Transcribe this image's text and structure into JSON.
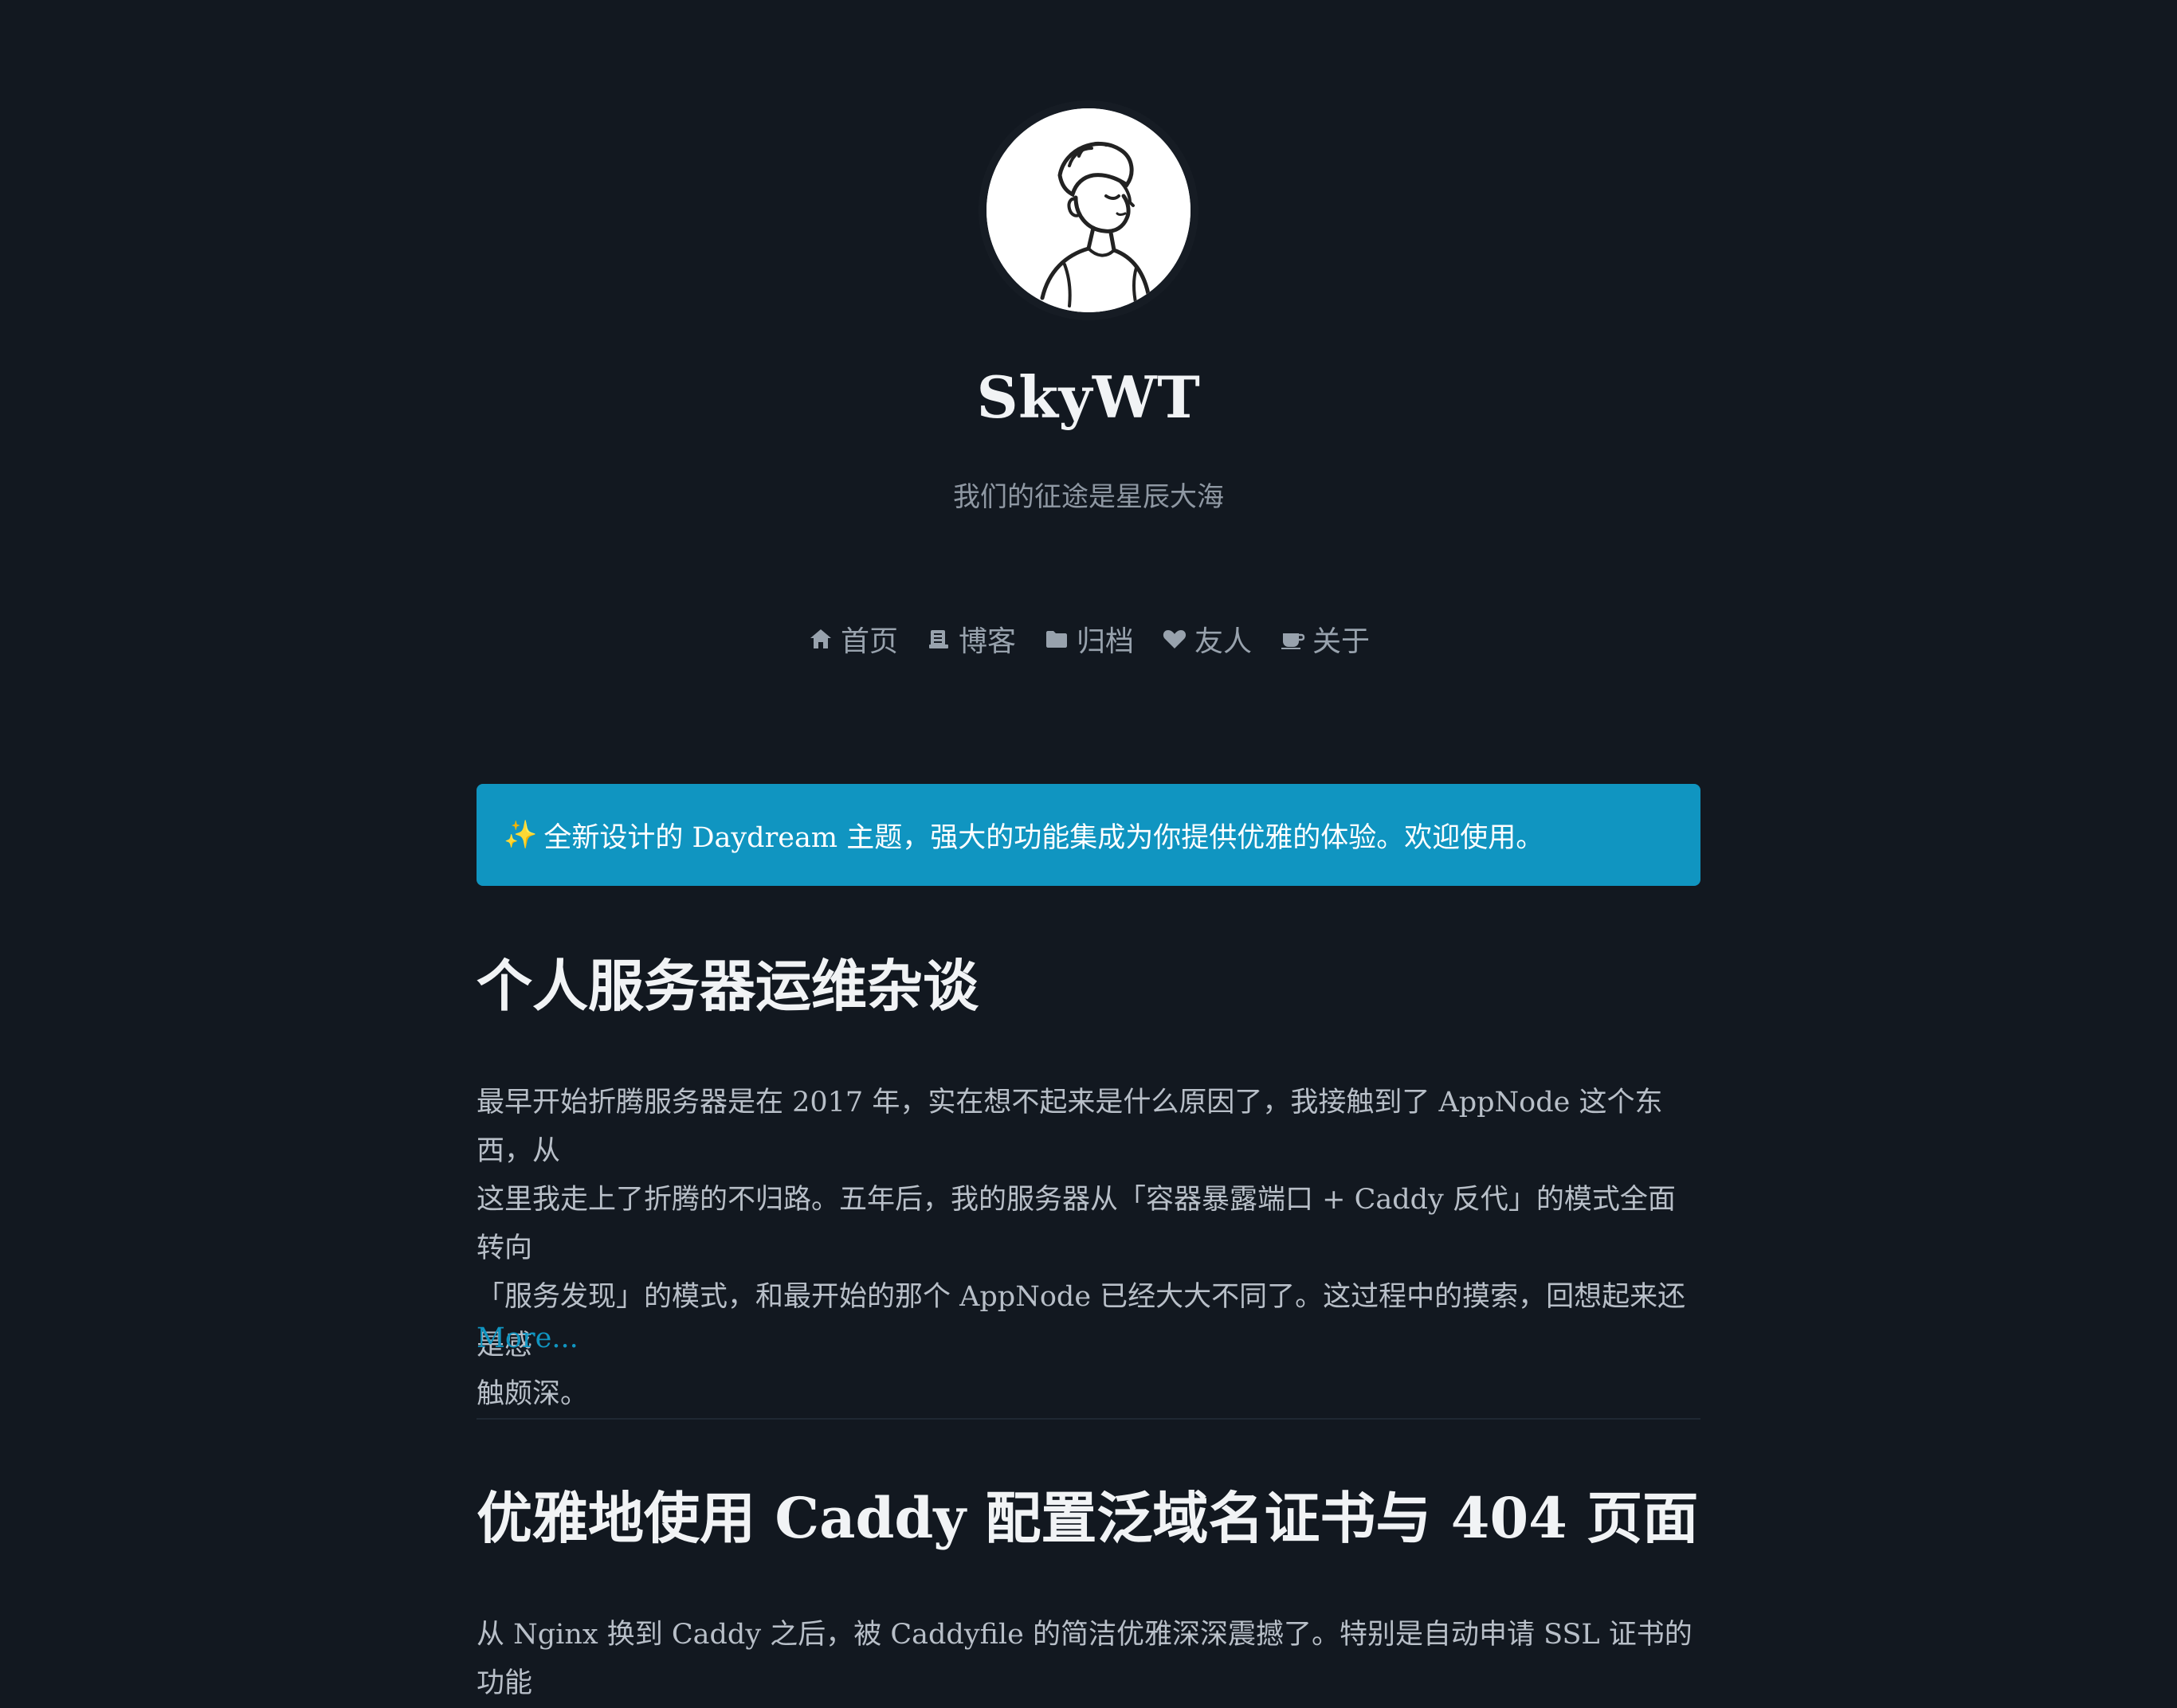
{
  "site": {
    "title": "SkyWT",
    "subtitle": "我们的征途是星辰大海"
  },
  "nav": [
    {
      "icon": "home-icon",
      "label": "首页"
    },
    {
      "icon": "blog-icon",
      "label": "博客"
    },
    {
      "icon": "folder-icon",
      "label": "归档"
    },
    {
      "icon": "heart-icon",
      "label": "友人"
    },
    {
      "icon": "coffee-icon",
      "label": "关于"
    }
  ],
  "notice": {
    "icon": "✨",
    "text": "全新设计的 Daydream 主题，强大的功能集成为你提供优雅的体验。欢迎使用。"
  },
  "posts": [
    {
      "title": "个人服务器运维杂谈",
      "excerpt_lines": [
        "最早开始折腾服务器是在 2017 年，实在想不起来是什么原因了，我接触到了 AppNode 这个东西，从",
        "这里我走上了折腾的不归路。五年后，我的服务器从「容器暴露端口 + Caddy 反代」的模式全面转向",
        "「服务发现」的模式，和最开始的那个 AppNode 已经大大不同了。这过程中的摸索，回想起来还是感",
        "触颇深。"
      ],
      "more": "More..."
    },
    {
      "title": "优雅地使用 Caddy 配置泛域名证书与 404 页面",
      "excerpt_lines": [
        "从 Nginx 换到 Caddy 之后，被 Caddyfile 的简洁优雅深深震撼了。特别是自动申请 SSL 证书的功能"
      ]
    }
  ],
  "colors": {
    "background": "#121820",
    "accent": "#1095c1",
    "title": "#f1f3f5",
    "text": "#b8bfc8",
    "muted": "#8f98a3"
  }
}
